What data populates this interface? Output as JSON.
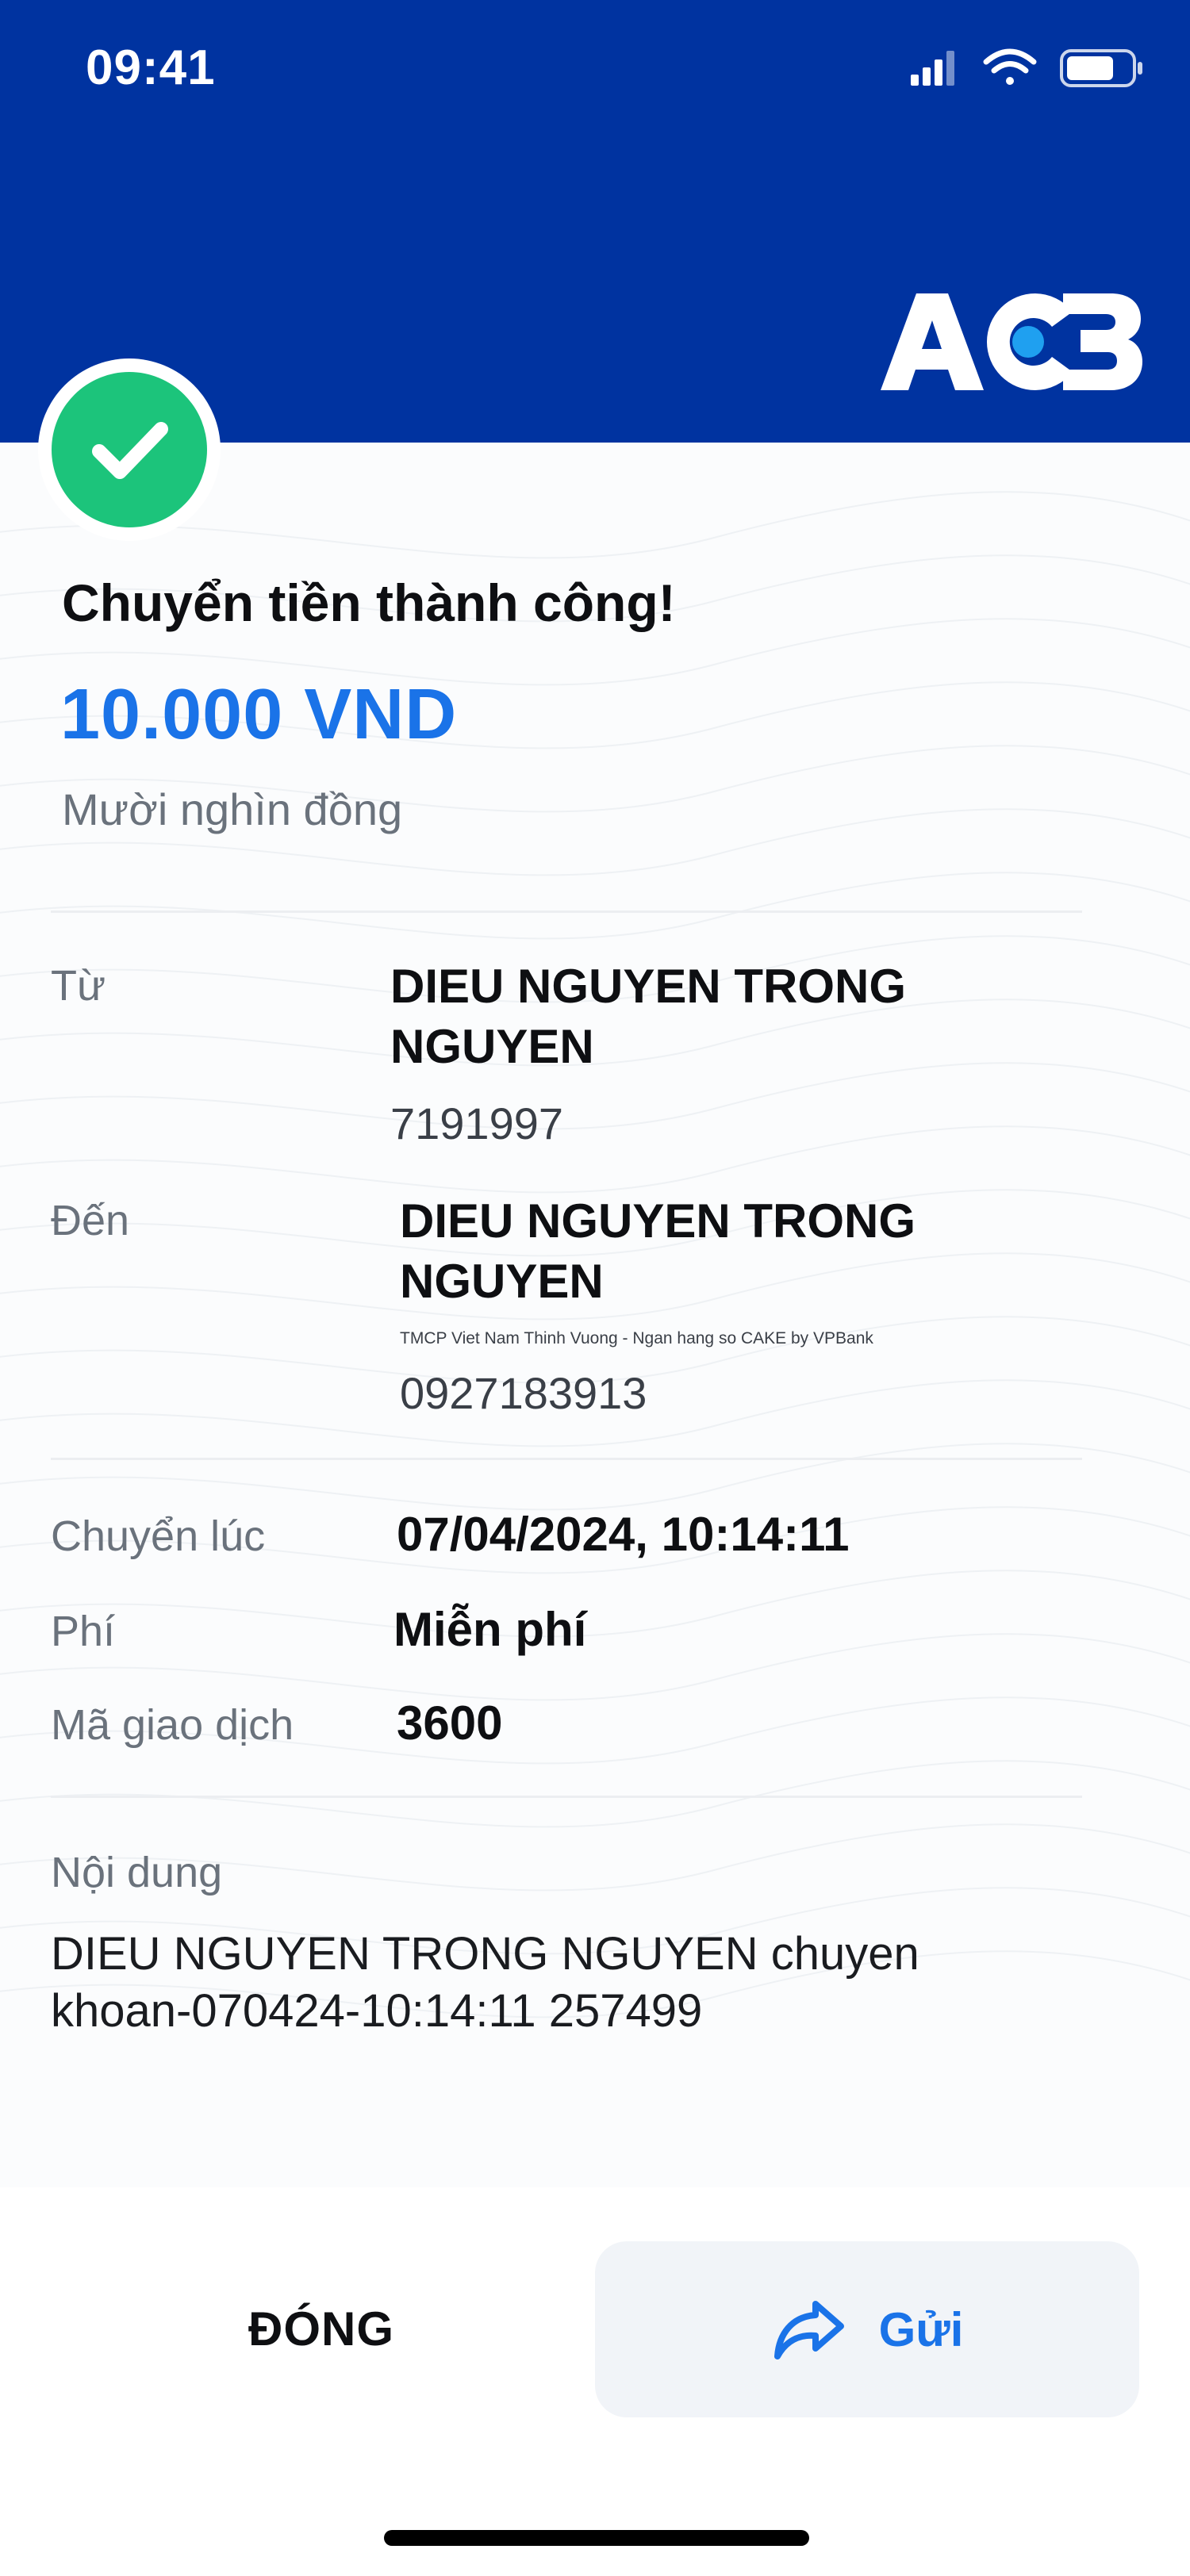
{
  "status_bar": {
    "time": "09:41",
    "signal_icon": "cellular-signal-icon",
    "wifi_icon": "wifi-icon",
    "battery_icon": "battery-icon"
  },
  "brand": {
    "logo_text": "ACB",
    "header_color": "#0033a0",
    "accent_color": "#1a73e8",
    "success_color": "#1cc47b"
  },
  "receipt": {
    "status_icon": "check-icon",
    "title": "Chuyển tiền thành công!",
    "amount": "10.000 VND",
    "amount_in_words": "Mười nghìn đồng",
    "from": {
      "label": "Từ",
      "name_line1": "DIEU NGUYEN TRONG",
      "name_line2": "NGUYEN",
      "account": "7191997"
    },
    "to": {
      "label": "Đến",
      "name_line1": "DIEU NGUYEN TRONG",
      "name_line2": "NGUYEN",
      "bank": "TMCP Viet Nam Thinh Vuong - Ngan hang so CAKE by VPBank",
      "account": "0927183913"
    },
    "time": {
      "label": "Chuyển lúc",
      "value": "07/04/2024, 10:14:11"
    },
    "fee": {
      "label": "Phí",
      "value": "Miễn phí"
    },
    "transaction_id": {
      "label": "Mã giao dịch",
      "value": "3600"
    },
    "content": {
      "label": "Nội dung",
      "line1": "DIEU NGUYEN TRONG NGUYEN chuyen",
      "line2": "khoan-070424-10:14:11 257499"
    }
  },
  "actions": {
    "close_label": "ĐÓNG",
    "send_label": "Gửi",
    "send_icon": "share-arrow-icon"
  }
}
